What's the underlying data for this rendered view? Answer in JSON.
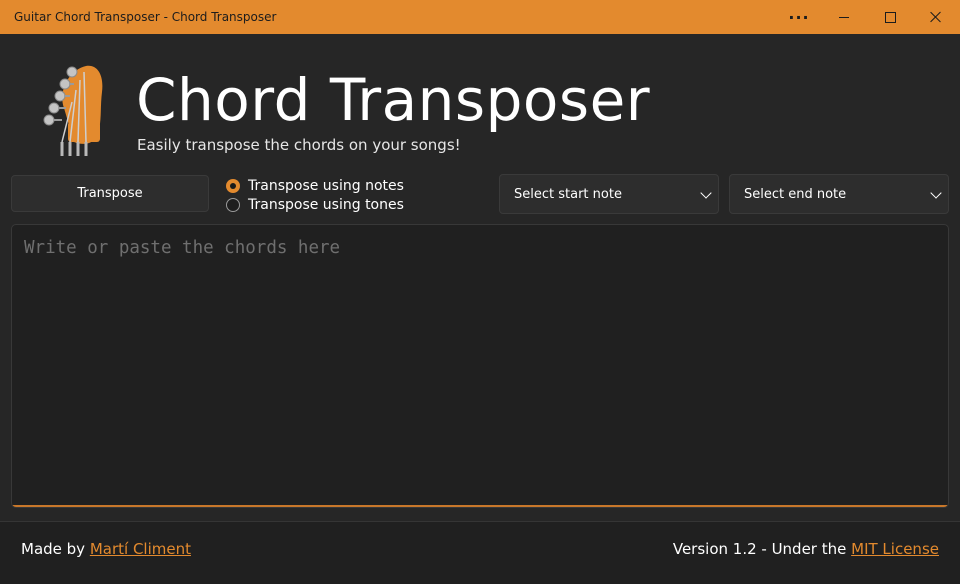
{
  "window": {
    "title": "Guitar Chord Transposer - Chord Transposer",
    "more_icon": "ellipsis-icon",
    "minimize_icon": "minimize-icon",
    "maximize_icon": "maximize-icon",
    "close_icon": "close-icon"
  },
  "header": {
    "logo_icon": "guitar-headstock-icon",
    "title": "Chord Transposer",
    "subtitle": "Easily transpose the chords on your songs!"
  },
  "controls": {
    "transpose_button": "Transpose",
    "mode_options": [
      {
        "label": "Transpose using notes",
        "selected": true
      },
      {
        "label": "Transpose using tones",
        "selected": false
      }
    ],
    "start_note_select": "Select start note",
    "end_note_select": "Select end note"
  },
  "editor": {
    "placeholder": "Write or paste the chords here",
    "value": ""
  },
  "footer": {
    "made_by_prefix": "Made by ",
    "author_link": "Martí Climent",
    "version_text": "Version 1.2 - Under the ",
    "license_link": "MIT License"
  },
  "colors": {
    "accent": "#e38a2e",
    "background": "#262626",
    "panel": "#2d2d2d",
    "editor_background": "#202020"
  }
}
